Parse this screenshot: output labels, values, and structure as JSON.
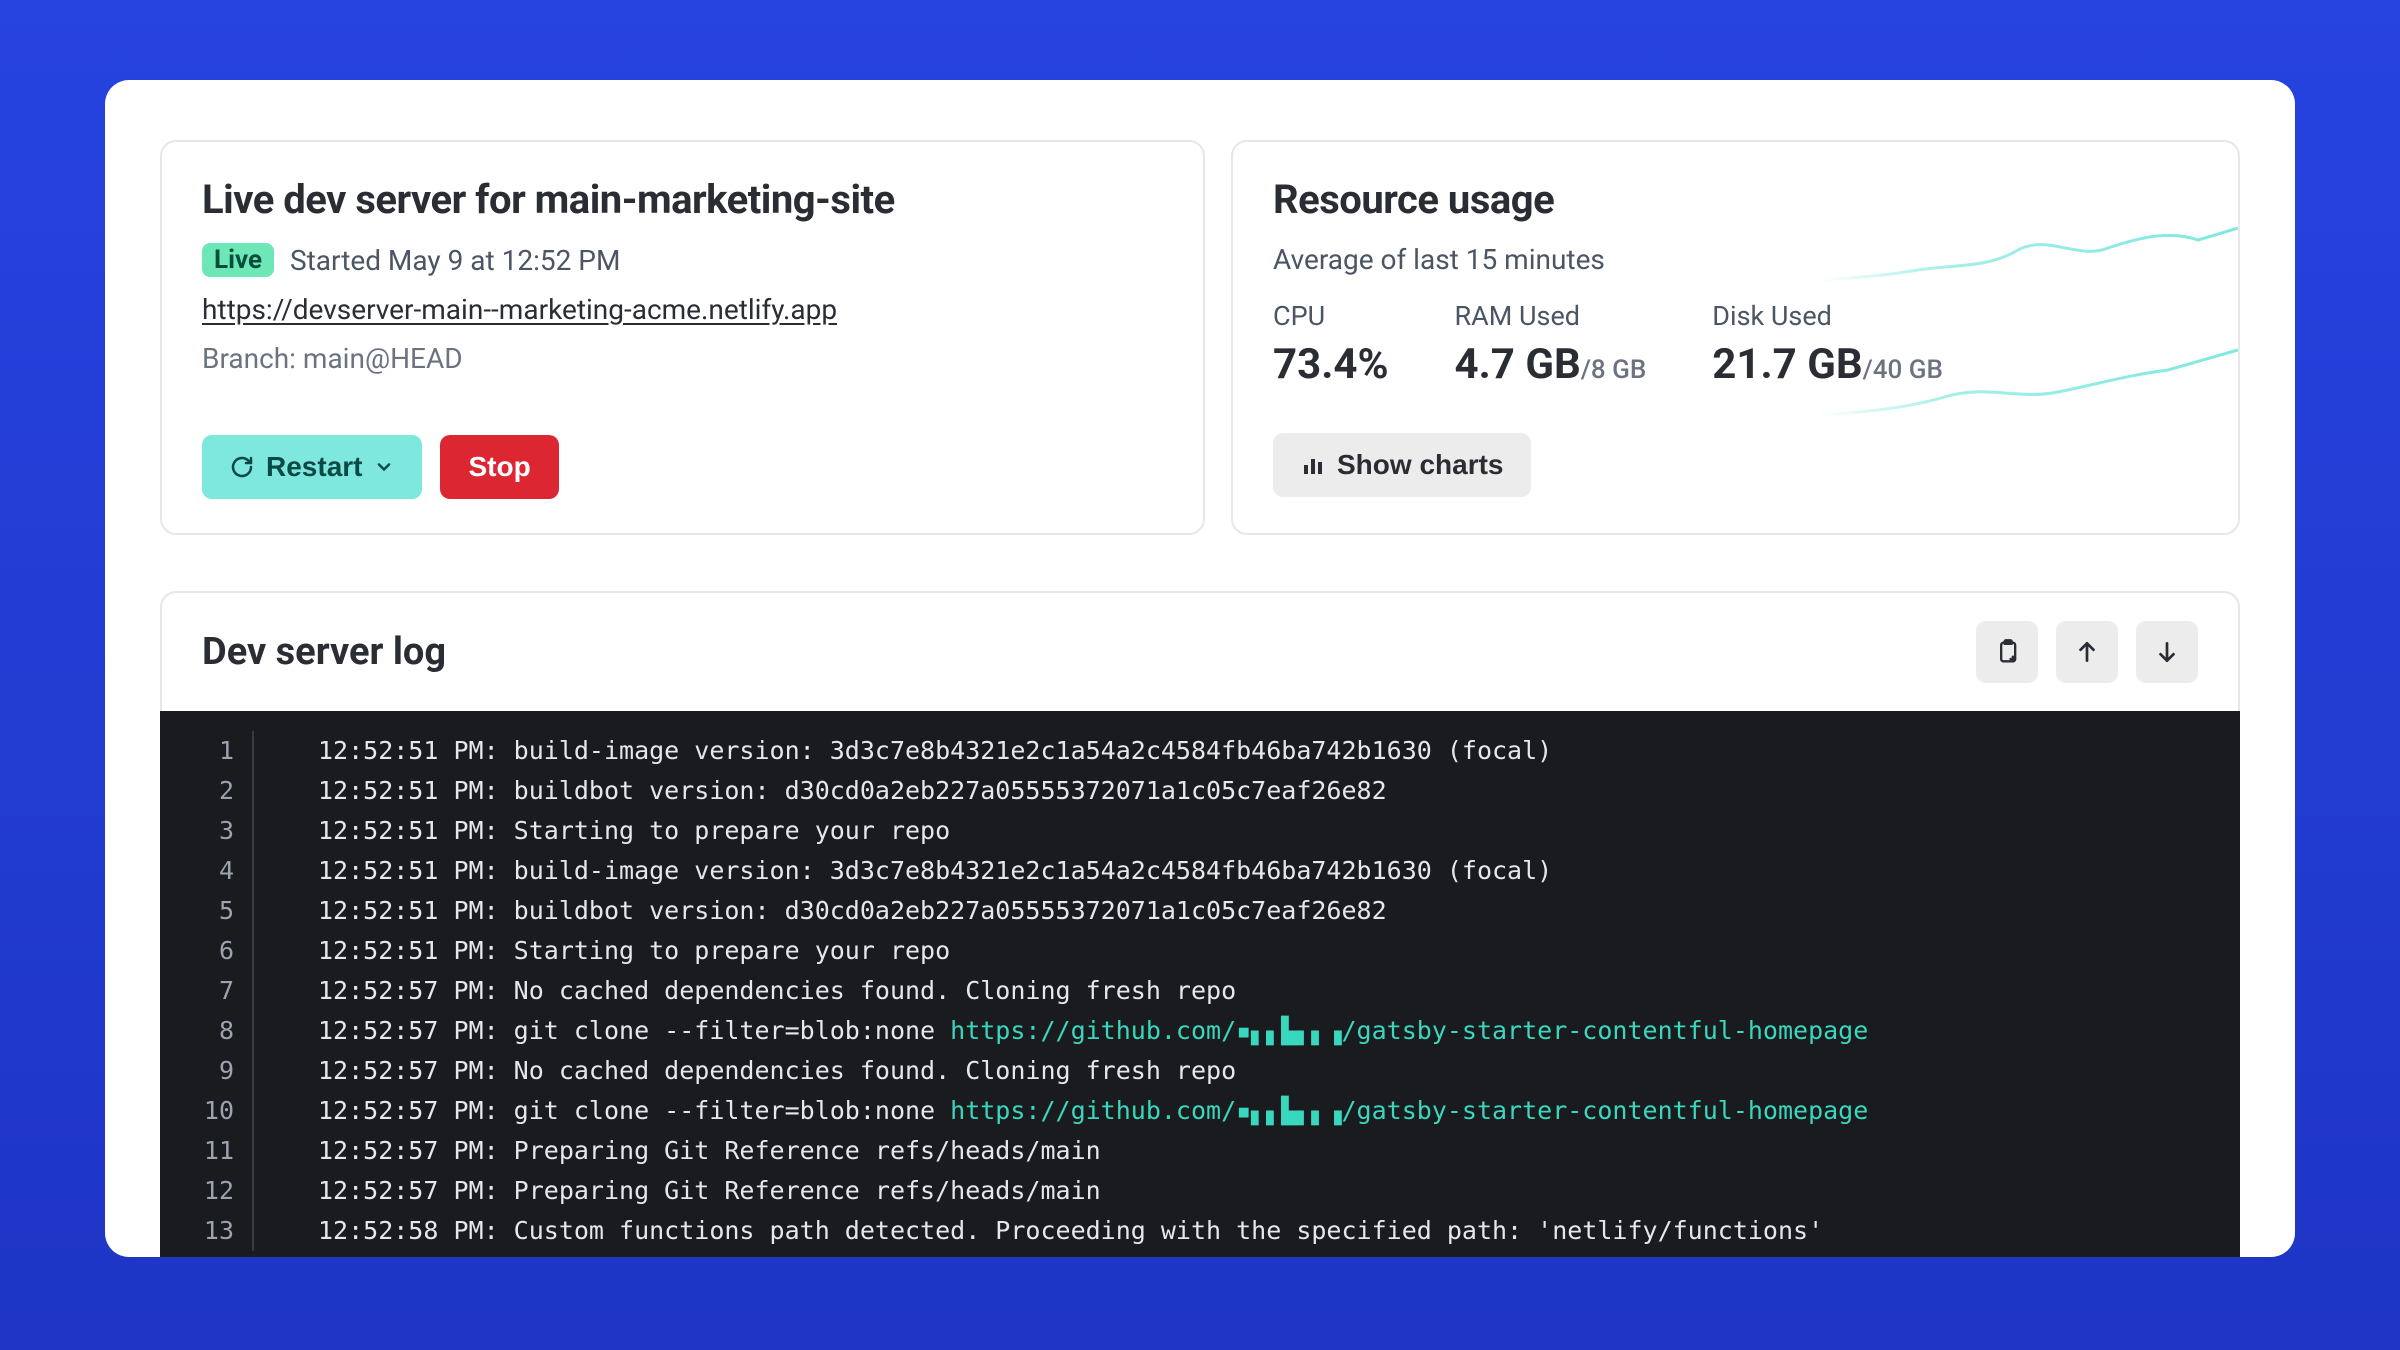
{
  "server": {
    "title": "Live dev server for main-marketing-site",
    "badge": "Live",
    "started": "Started May 9 at 12:52 PM",
    "url": "https://devserver-main--marketing-acme.netlify.app",
    "branch": "Branch: main@HEAD",
    "restart_label": "Restart",
    "stop_label": "Stop"
  },
  "resource": {
    "title": "Resource usage",
    "subtitle": "Average of last 15 minutes",
    "cpu_label": "CPU",
    "cpu_value": "73.4%",
    "ram_label": "RAM Used",
    "ram_value": "4.7 GB",
    "ram_total": "/8 GB",
    "disk_label": "Disk Used",
    "disk_value": "21.7 GB",
    "disk_total": "/40 GB",
    "show_charts_label": "Show charts"
  },
  "log": {
    "title": "Dev server log",
    "lines": [
      {
        "n": "1",
        "ts": "12:52:51 PM:",
        "msg": "build-image version: 3d3c7e8b4321e2c1a54a2c4584fb46ba742b1630 (focal)"
      },
      {
        "n": "2",
        "ts": "12:52:51 PM:",
        "msg": "buildbot version: d30cd0a2eb227a05555372071a1c05c7eaf26e82"
      },
      {
        "n": "3",
        "ts": "12:52:51 PM:",
        "msg": "Starting to prepare your repo"
      },
      {
        "n": "4",
        "ts": "12:52:51 PM:",
        "msg": "build-image version: 3d3c7e8b4321e2c1a54a2c4584fb46ba742b1630 (focal)"
      },
      {
        "n": "5",
        "ts": "12:52:51 PM:",
        "msg": "buildbot version: d30cd0a2eb227a05555372071a1c05c7eaf26e82"
      },
      {
        "n": "6",
        "ts": "12:52:51 PM:",
        "msg": "Starting to prepare your repo"
      },
      {
        "n": "7",
        "ts": "12:52:57 PM:",
        "msg": "No cached dependencies found. Cloning fresh repo"
      },
      {
        "n": "8",
        "ts": "12:52:57 PM:",
        "msg": "git clone --filter=blob:none ",
        "link": "https://github.com/▪▖▖▙▖▖▗/gatsby-starter-contentful-homepage"
      },
      {
        "n": "9",
        "ts": "12:52:57 PM:",
        "msg": "No cached dependencies found. Cloning fresh repo"
      },
      {
        "n": "10",
        "ts": "12:52:57 PM:",
        "msg": "git clone --filter=blob:none ",
        "link": "https://github.com/▪▖▖▙▖▖▗/gatsby-starter-contentful-homepage"
      },
      {
        "n": "11",
        "ts": "12:52:57 PM:",
        "msg": "Preparing Git Reference refs/heads/main"
      },
      {
        "n": "12",
        "ts": "12:52:57 PM:",
        "msg": "Preparing Git Reference refs/heads/main"
      },
      {
        "n": "13",
        "ts": "12:52:58 PM:",
        "msg": "Custom functions path detected. Proceeding with the specified path: 'netlify/functions'"
      }
    ]
  }
}
